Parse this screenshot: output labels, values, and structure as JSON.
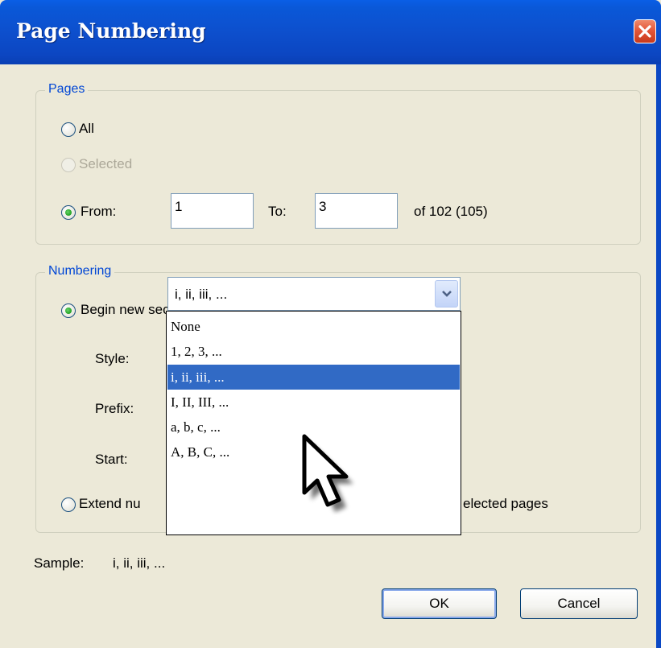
{
  "window": {
    "title": "Page Numbering"
  },
  "pages_group": {
    "legend": "Pages",
    "all_label": "All",
    "selected_label": "Selected",
    "from_label": "From:",
    "from_value": "1",
    "to_label": "To:",
    "to_value": "3",
    "of_text": "of 102 (105)"
  },
  "numbering_group": {
    "legend": "Numbering",
    "begin_label": "Begin new section",
    "style_label": "Style:",
    "style_value": "i, ii, iii, ...",
    "prefix_label": "Prefix:",
    "start_label": "Start:",
    "extend_label_left": "Extend nu",
    "extend_label_right": "elected pages",
    "style_options": [
      "None",
      "1, 2, 3, ...",
      "i, ii, iii, ...",
      "I, II, III, ...",
      "a, b, c, ...",
      "A, B, C, ..."
    ],
    "highlighted_option": "i, ii, iii, ..."
  },
  "sample": {
    "label": "Sample:",
    "value": "i, ii, iii, ..."
  },
  "buttons": {
    "ok": "OK",
    "cancel": "Cancel"
  },
  "icons": {
    "close": "close-icon",
    "dropdown": "chevron-down-icon",
    "cursor": "mouse-pointer-icon"
  },
  "colors": {
    "titlebar": "#0a58d8",
    "legend_text": "#0046d5",
    "selection": "#316ac5",
    "close_button": "#e4573a",
    "radio_dot": "#21a121"
  }
}
